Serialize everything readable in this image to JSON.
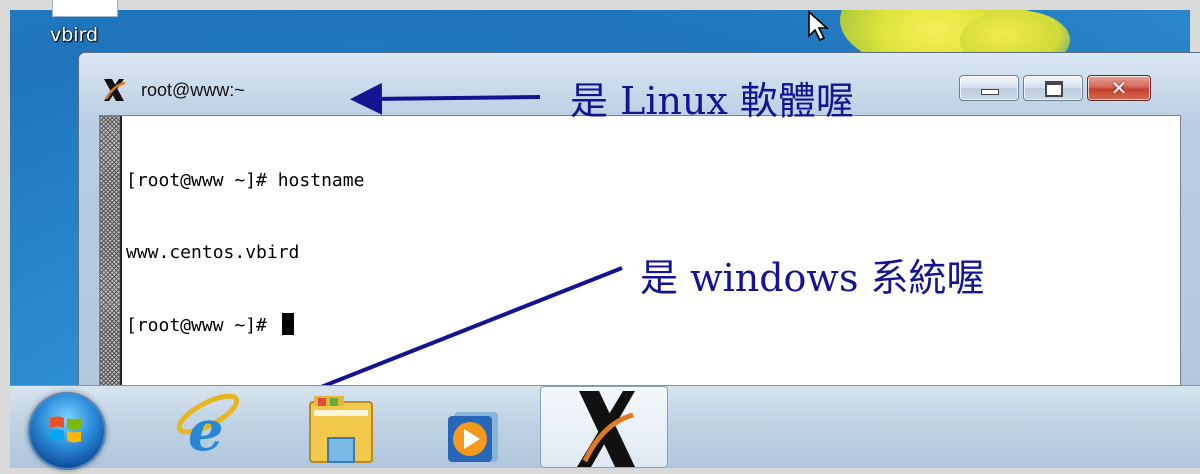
{
  "desktop": {
    "icon_label": "vbird"
  },
  "window": {
    "title": "root@www:~",
    "buttons": {
      "minimize_icon": "minimize-icon",
      "maximize_icon": "maximize-icon",
      "close_icon": "close-icon"
    }
  },
  "terminal": {
    "lines": [
      "[root@www ~]# hostname",
      "www.centos.vbird",
      "[root@www ~]# "
    ]
  },
  "annotations": {
    "linux": "是 Linux 軟體喔",
    "windows": "是 windows 系統喔",
    "color": "#141493"
  },
  "taskbar": {
    "items": [
      {
        "icon": "windows-start-orb-icon"
      },
      {
        "icon": "internet-explorer-icon"
      },
      {
        "icon": "file-explorer-icon"
      },
      {
        "icon": "media-player-icon"
      },
      {
        "icon": "xming-x-icon"
      }
    ]
  },
  "colors": {
    "taskbar": "#bfd3e4",
    "desktop": "#2c8dd0",
    "close_button": "#c4412f"
  }
}
